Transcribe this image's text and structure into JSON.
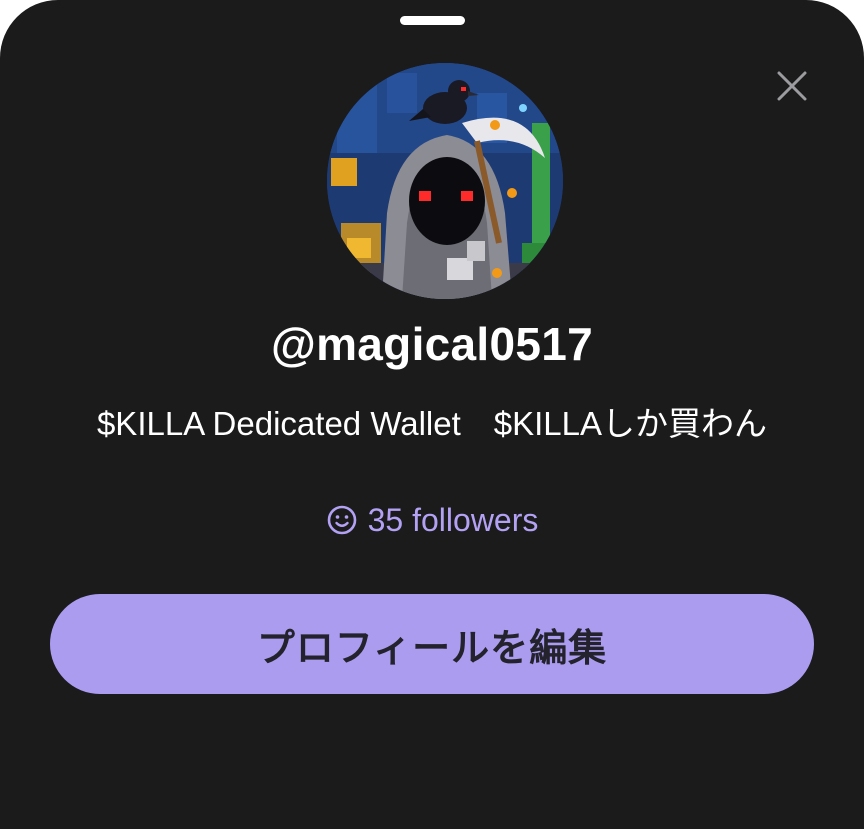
{
  "profile": {
    "username": "@magical0517",
    "bio": "$KILLA Dedicated Wallet　$KILLAしか買わん",
    "followers_text": "35 followers",
    "followers_count": 35,
    "avatar_description_icon": "grim-reaper-avatar"
  },
  "actions": {
    "edit_profile_label": "プロフィールを編集",
    "close_icon": "close-icon",
    "smiley_icon": "smiley-icon"
  },
  "colors": {
    "background": "#1b1b1c",
    "accent": "#ab9cf0",
    "followers_text": "#b3a1f4",
    "button_text": "#24222c"
  }
}
